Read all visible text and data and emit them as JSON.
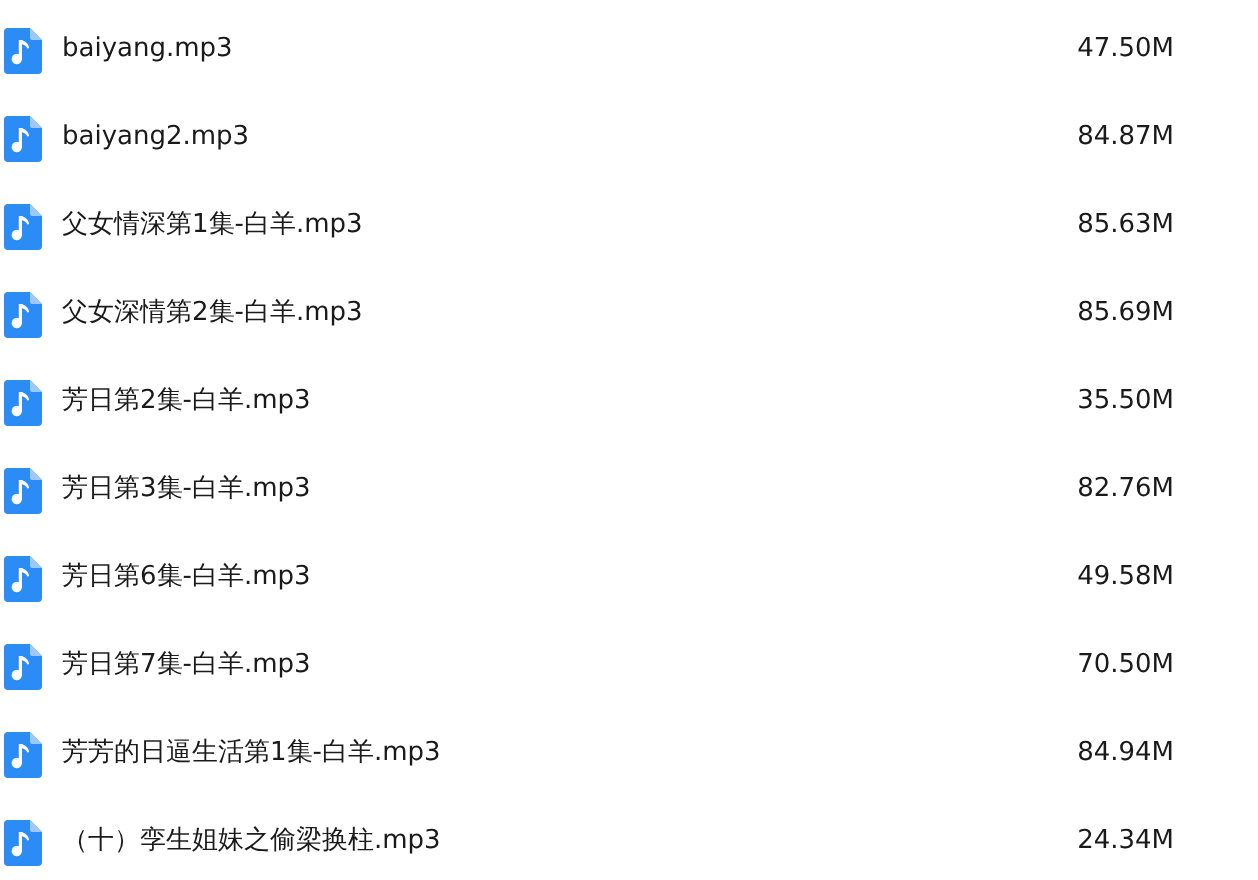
{
  "files": [
    {
      "name": "baiyang.mp3",
      "size": "47.50M"
    },
    {
      "name": "baiyang2.mp3",
      "size": "84.87M"
    },
    {
      "name": "父女情深第1集-白羊.mp3",
      "size": "85.63M"
    },
    {
      "name": "父女深情第2集-白羊.mp3",
      "size": "85.69M"
    },
    {
      "name": "芳日第2集-白羊.mp3",
      "size": "35.50M"
    },
    {
      "name": "芳日第3集-白羊.mp3",
      "size": "82.76M"
    },
    {
      "name": "芳日第6集-白羊.mp3",
      "size": "49.58M"
    },
    {
      "name": "芳日第7集-白羊.mp3",
      "size": "70.50M"
    },
    {
      "name": "芳芳的日逼生活第1集-白羊.mp3",
      "size": "84.94M"
    },
    {
      "name": "（十）孪生姐妹之偷梁换柱.mp3",
      "size": "24.34M"
    }
  ]
}
